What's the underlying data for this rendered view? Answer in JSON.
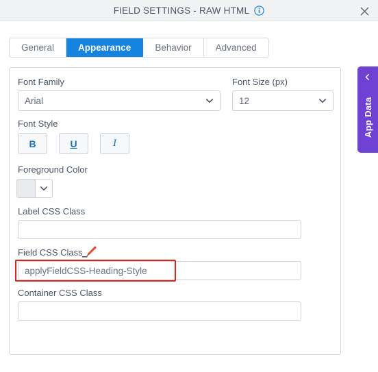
{
  "window": {
    "title": "FIELD SETTINGS - RAW HTML",
    "info_icon": "info-circle-icon",
    "close_icon": "close-icon"
  },
  "tabs": [
    {
      "label": "General",
      "active": false
    },
    {
      "label": "Appearance",
      "active": true
    },
    {
      "label": "Behavior",
      "active": false
    },
    {
      "label": "Advanced",
      "active": false
    }
  ],
  "form": {
    "font_family": {
      "label": "Font Family",
      "value": "Arial",
      "chevron_icon": "chevron-down-icon"
    },
    "font_size": {
      "label": "Font Size (px)",
      "value": "12",
      "chevron_icon": "chevron-down-icon"
    },
    "font_style": {
      "label": "Font Style",
      "bold_label": "B",
      "underline_label": "U",
      "italic_label": "I"
    },
    "foreground_color": {
      "label": "Foreground Color",
      "swatch_color": "#e9eaec",
      "chevron_icon": "chevron-down-icon"
    },
    "label_css_class": {
      "label": "Label CSS Class",
      "value": "",
      "placeholder": ""
    },
    "field_css_class": {
      "label": "Field CSS Class",
      "value": "applyFieldCSS-Heading-Style",
      "placeholder": "",
      "edit_icon": "pencil-edit-icon",
      "highlight_color": "#d9261c"
    },
    "container_css_class": {
      "label": "Container CSS Class",
      "value": "",
      "placeholder": ""
    }
  },
  "side_panel": {
    "label": "App Data",
    "chevron_icon": "chevron-left-icon",
    "accent_color": "#6f42d4"
  },
  "colors": {
    "accent_blue": "#1583e0",
    "title_gray": "#4a5568",
    "header_bg": "#f1f2f4"
  }
}
